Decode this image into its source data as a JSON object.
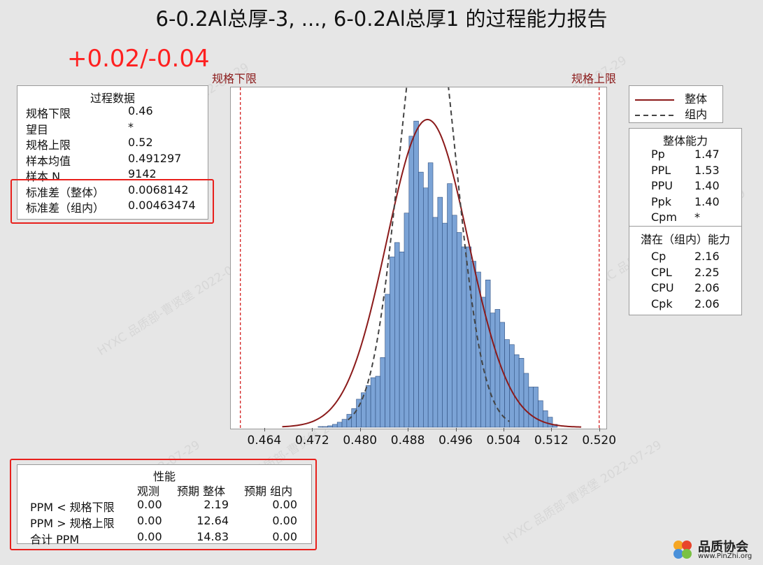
{
  "title": "6-0.2Al总厚-3, ..., 6-0.2Al总厚1 的过程能力报告",
  "annotation": "+0.02/-0.04",
  "watermark": "HYXC 品质部-曹贤堡 2022-07-29",
  "process_data": {
    "header": "过程数据",
    "rows": [
      {
        "label": "规格下限",
        "value": "0.46"
      },
      {
        "label": "望目",
        "value": "*"
      },
      {
        "label": "规格上限",
        "value": "0.52"
      },
      {
        "label": "样本均值",
        "value": "0.491297"
      },
      {
        "label": "样本 N",
        "value": "9142"
      },
      {
        "label": "标准差（整体）",
        "value": "0.0068142"
      },
      {
        "label": "标准差（组内）",
        "value": "0.00463474"
      }
    ]
  },
  "legend": {
    "items": [
      {
        "label": "整体",
        "style": "solid",
        "color": "#8b1a1a"
      },
      {
        "label": "组内",
        "style": "dashed",
        "color": "#444444"
      }
    ]
  },
  "overall_capability": {
    "header": "整体能力",
    "rows": [
      {
        "label": "Pp",
        "value": "1.47"
      },
      {
        "label": "PPL",
        "value": "1.53"
      },
      {
        "label": "PPU",
        "value": "1.40"
      },
      {
        "label": "Ppk",
        "value": "1.40"
      },
      {
        "label": "Cpm",
        "value": "*"
      }
    ]
  },
  "potential_capability": {
    "header": "潜在（组内）能力",
    "rows": [
      {
        "label": "Cp",
        "value": "2.16"
      },
      {
        "label": "CPL",
        "value": "2.25"
      },
      {
        "label": "CPU",
        "value": "2.06"
      },
      {
        "label": "Cpk",
        "value": "2.06"
      }
    ]
  },
  "performance": {
    "header": "性能",
    "columns": [
      "观测",
      "预期 整体",
      "预期 组内"
    ],
    "rows": [
      {
        "label": "PPM < 规格下限",
        "observed": "0.00",
        "expected_overall": "2.19",
        "expected_within": "0.00"
      },
      {
        "label": "PPM > 规格上限",
        "observed": "0.00",
        "expected_overall": "12.64",
        "expected_within": "0.00"
      },
      {
        "label": "合计 PPM",
        "observed": "0.00",
        "expected_overall": "14.83",
        "expected_within": "0.00"
      }
    ]
  },
  "logo": {
    "text": "品质协会",
    "url_text": "www.PinZhi.org"
  },
  "colors": {
    "bar_fill": "#7ba3d6",
    "bar_stroke": "#2f4f7f",
    "spec_line": "#d42020",
    "overall_curve": "#8b1a1a",
    "within_curve": "#444444",
    "highlight": "#e8201c"
  },
  "chart_data": {
    "type": "histogram",
    "xlim": [
      0.4584,
      0.5212
    ],
    "ticks": [
      "0.464",
      "0.472",
      "0.480",
      "0.488",
      "0.496",
      "0.504",
      "0.512",
      "0.520"
    ],
    "tick_values": [
      0.464,
      0.472,
      0.48,
      0.488,
      0.496,
      0.504,
      0.512,
      0.52
    ],
    "spec_limits": {
      "lsl": 0.46,
      "usl": 0.52,
      "lsl_label": "规格下限",
      "usl_label": "规格上限"
    },
    "bin_start": 0.473,
    "bin_width": 0.0008,
    "counts": [
      1,
      1,
      2,
      4,
      7,
      11,
      18,
      26,
      39,
      48,
      58,
      69,
      71,
      97,
      185,
      237,
      257,
      244,
      298,
      405,
      426,
      355,
      333,
      368,
      292,
      320,
      284,
      339,
      295,
      271,
      251,
      251,
      231,
      216,
      181,
      205,
      159,
      164,
      146,
      122,
      115,
      101,
      96,
      75,
      56,
      56,
      37,
      23,
      14,
      4
    ],
    "ylim": [
      0,
      468
    ],
    "mean": 0.491297,
    "stdev_overall": 0.0068142,
    "stdev_within": 0.00463474,
    "n": 9142,
    "curve_overall_range": [
      0.467,
      0.517
    ],
    "curve_within_range": [
      0.478,
      0.505
    ]
  }
}
